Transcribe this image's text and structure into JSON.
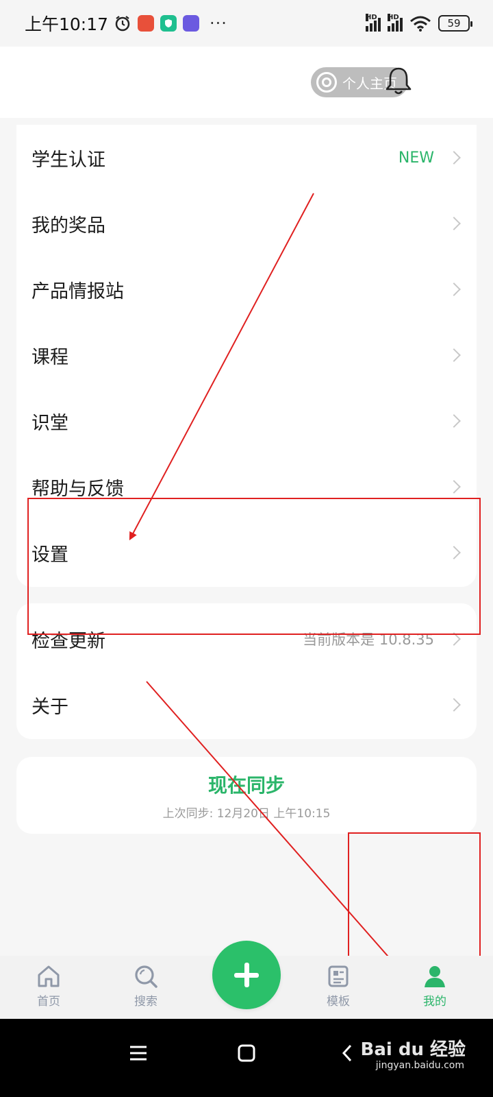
{
  "status_bar": {
    "time": "上午10:17",
    "more": "···",
    "battery": "59",
    "hd1": "HD",
    "hd2": "HD"
  },
  "header": {
    "profile_button": "个人主页"
  },
  "menu_main": [
    {
      "label": "学生认证",
      "extra": "NEW"
    },
    {
      "label": "我的奖品",
      "extra": ""
    },
    {
      "label": "产品情报站",
      "extra": ""
    },
    {
      "label": "课程",
      "extra": ""
    },
    {
      "label": "识堂",
      "extra": ""
    },
    {
      "label": "帮助与反馈",
      "extra": ""
    },
    {
      "label": "设置",
      "extra": ""
    }
  ],
  "menu_secondary": [
    {
      "label": "检查更新",
      "extra": "当前版本是 10.8.35"
    },
    {
      "label": "关于",
      "extra": ""
    }
  ],
  "sync": {
    "title": "现在同步",
    "subtitle": "上次同步: 12月20日 上午10:15"
  },
  "bottom_nav": {
    "home": "首页",
    "search": "搜索",
    "templates": "模板",
    "me": "我的"
  },
  "watermark": {
    "brand": "Bai du 经验",
    "url": "jingyan.baidu.com"
  },
  "colors": {
    "accent": "#2bb56a",
    "annotation": "#e02020"
  }
}
